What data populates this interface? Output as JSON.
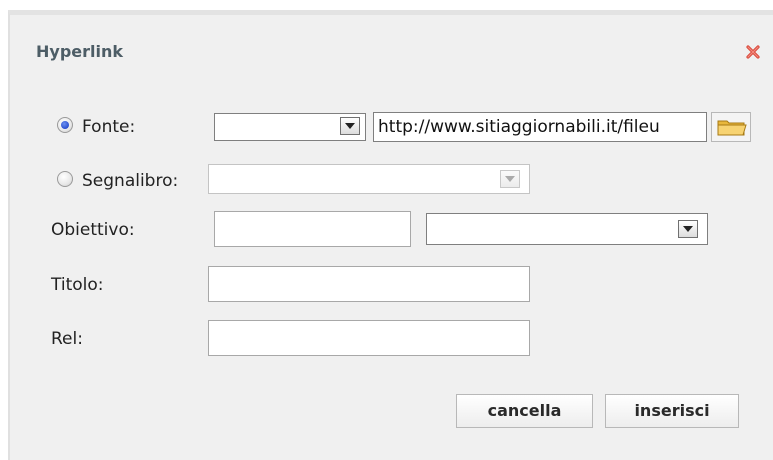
{
  "dialog": {
    "title": "Hyperlink",
    "close_icon": "close-x-icon"
  },
  "form": {
    "fonte": {
      "label": "Fonte:",
      "selected": true,
      "protocol_value": "",
      "url_value": "http://www.sitiaggiornabili.it/fileu",
      "browse_icon": "folder-icon"
    },
    "segnalibro": {
      "label": "Segnalibro:",
      "selected": false,
      "value": ""
    },
    "obiettivo": {
      "label": "Obiettivo:",
      "text_value": "",
      "select_value": ""
    },
    "titolo": {
      "label": "Titolo:",
      "value": ""
    },
    "rel": {
      "label": "Rel:",
      "value": ""
    }
  },
  "buttons": {
    "cancel_label": "cancella",
    "insert_label": "inserisci"
  },
  "colors": {
    "dialog_bg": "#f0f0f0",
    "title_text": "#4d5d66",
    "close_icon": "#e0453a",
    "radio_selected": "#2a4fd0"
  }
}
